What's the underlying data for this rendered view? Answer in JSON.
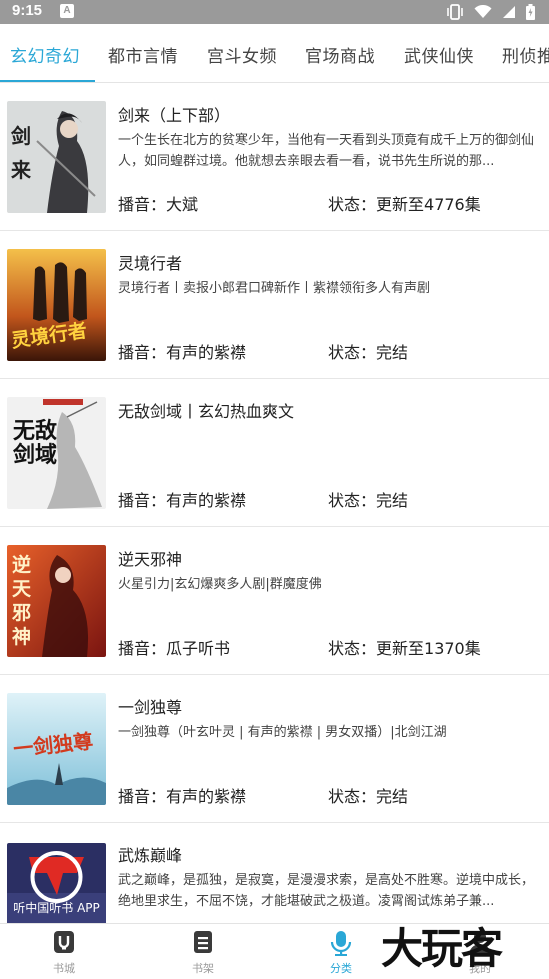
{
  "status_bar": {
    "time": "9:15",
    "notification_badge": "A"
  },
  "tabs": [
    {
      "label": "玄幻奇幻",
      "active": true
    },
    {
      "label": "都市言情",
      "active": false
    },
    {
      "label": "宫斗女频",
      "active": false
    },
    {
      "label": "官场商战",
      "active": false
    },
    {
      "label": "武侠仙侠",
      "active": false
    },
    {
      "label": "刑侦推",
      "active": false
    }
  ],
  "books": [
    {
      "title": "剑来（上下部）",
      "description": "一个生长在北方的贫寒少年，当他有一天看到头顶竟有成千上万的御剑仙人，如同蝗群过境。他就想去亲眼去看一看，说书先生所说的那...",
      "narrator_label": "播音：",
      "narrator": "大斌",
      "status_label": "状态：",
      "status": "更新至4776集",
      "cover_text": "剑来",
      "cover_color": "#cfd3d4"
    },
    {
      "title": "灵境行者",
      "description": "灵境行者丨卖报小郎君口碑新作丨紫襟领衔多人有声剧",
      "narrator_label": "播音：",
      "narrator": "有声的紫襟",
      "status_label": "状态：",
      "status": "完结",
      "cover_text": "灵境行者",
      "cover_color": "#8b3a12"
    },
    {
      "title": "无敌剑域丨玄幻热血爽文",
      "description": "",
      "narrator_label": "播音：",
      "narrator": "有声的紫襟",
      "status_label": "状态：",
      "status": "完结",
      "cover_text": "无敌剑域",
      "cover_color": "#eeeeee"
    },
    {
      "title": "逆天邪神",
      "description": "火星引力|玄幻爆爽多人剧|群魔度佛",
      "narrator_label": "播音：",
      "narrator": "瓜子听书",
      "status_label": "状态：",
      "status": "更新至1370集",
      "cover_text": "逆天邪神",
      "cover_color": "#c8391d"
    },
    {
      "title": "一剑独尊",
      "description": "一剑独尊（叶玄叶灵 | 有声的紫襟 | 男女双播）|北剑江湖",
      "narrator_label": "播音：",
      "narrator": "有声的紫襟",
      "status_label": "状态：",
      "status": "完结",
      "cover_text": "一剑独尊",
      "cover_color": "#bfe3ef"
    },
    {
      "title": "武炼巅峰",
      "description": "武之巅峰，是孤独，是寂寞，是漫漫求索，是高处不胜寒。逆境中成长，绝地里求生，不屈不饶，才能堪破武之极道。凌霄阁试炼弟子兼...",
      "narrator_label": "",
      "narrator": "",
      "status_label": "",
      "status": "",
      "cover_text": "听中国听书 APP",
      "cover_color": "#2b2f63"
    }
  ],
  "bottom_nav": [
    {
      "label": "书城",
      "icon": "store-icon",
      "active": false
    },
    {
      "label": "书架",
      "icon": "bookshelf-icon",
      "active": false
    },
    {
      "label": "分类",
      "icon": "microphone-icon",
      "active": true
    },
    {
      "label": "我的",
      "icon": "profile-icon",
      "active": false
    }
  ],
  "watermark": "大玩客",
  "colors": {
    "accent": "#2aa7d6",
    "status_bar": "#9a9a9a"
  }
}
